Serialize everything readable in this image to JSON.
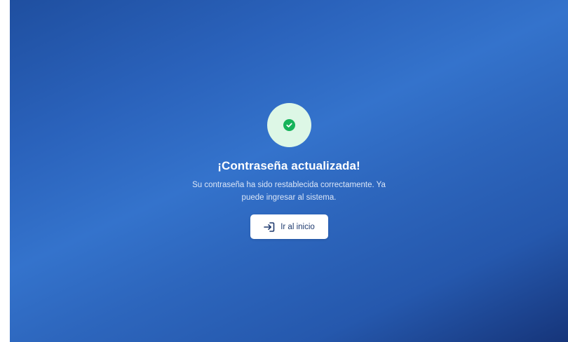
{
  "success": {
    "icon": "check-circle-icon",
    "title": "¡Contraseña actualizada!",
    "message": "Su contraseña ha sido restablecida correctamente. Ya puede ingresar al sistema.",
    "button_label": "Ir al inicio",
    "button_icon": "login-icon"
  },
  "colors": {
    "background_gradient": [
      "#1f4fa0",
      "#3473cc",
      "#16357a"
    ],
    "success_green": "#16b35a",
    "success_circle_bg": "#ddf7e6",
    "button_text": "#1e3a6e"
  }
}
